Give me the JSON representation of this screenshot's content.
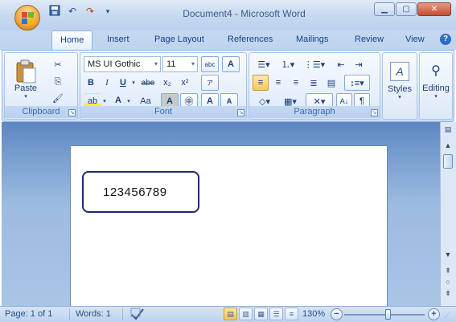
{
  "window": {
    "title": "Document4 - Microsoft Word",
    "minimize_glyph": "▁",
    "maximize_glyph": "▢",
    "close_glyph": "✕"
  },
  "quick_access": {
    "save_icon": "save-icon",
    "undo_icon": "undo-icon",
    "redo_icon": "redo-icon",
    "customize_icon": "customize-dropdown-icon"
  },
  "tabs": [
    {
      "label": "Home",
      "active": true
    },
    {
      "label": "Insert"
    },
    {
      "label": "Page Layout"
    },
    {
      "label": "References"
    },
    {
      "label": "Mailings"
    },
    {
      "label": "Review"
    },
    {
      "label": "View"
    }
  ],
  "help_glyph": "?",
  "ribbon": {
    "clipboard": {
      "label": "Clipboard",
      "paste": "Paste"
    },
    "font": {
      "label": "Font",
      "font_name": "MS UI Gothic",
      "font_size": "11",
      "bold": "B",
      "italic": "I",
      "underline": "U",
      "strike": "abe",
      "subscript": "x₂",
      "superscript": "x²",
      "change_case": "Aa",
      "grow": "A",
      "shrink": "A",
      "clear_format": "abc",
      "char_shading": "A",
      "enclose": "㊥",
      "font_color": "A",
      "highlight": "ab"
    },
    "paragraph": {
      "label": "Paragraph",
      "pilcrow": "¶"
    },
    "styles": {
      "label": "Styles"
    },
    "editing": {
      "label": "Editing"
    }
  },
  "document": {
    "textbox_content": "123456789"
  },
  "status_bar": {
    "page": "Page: 1 of 1",
    "words": "Words: 1",
    "zoom": "130%",
    "zoom_minus": "−",
    "zoom_plus": "+"
  },
  "colors": {
    "accent": "#15428b",
    "ribbon_bg": "#dbe7f8",
    "workspace": "#7aa0d1",
    "textbox_border": "#1c2a6e"
  }
}
